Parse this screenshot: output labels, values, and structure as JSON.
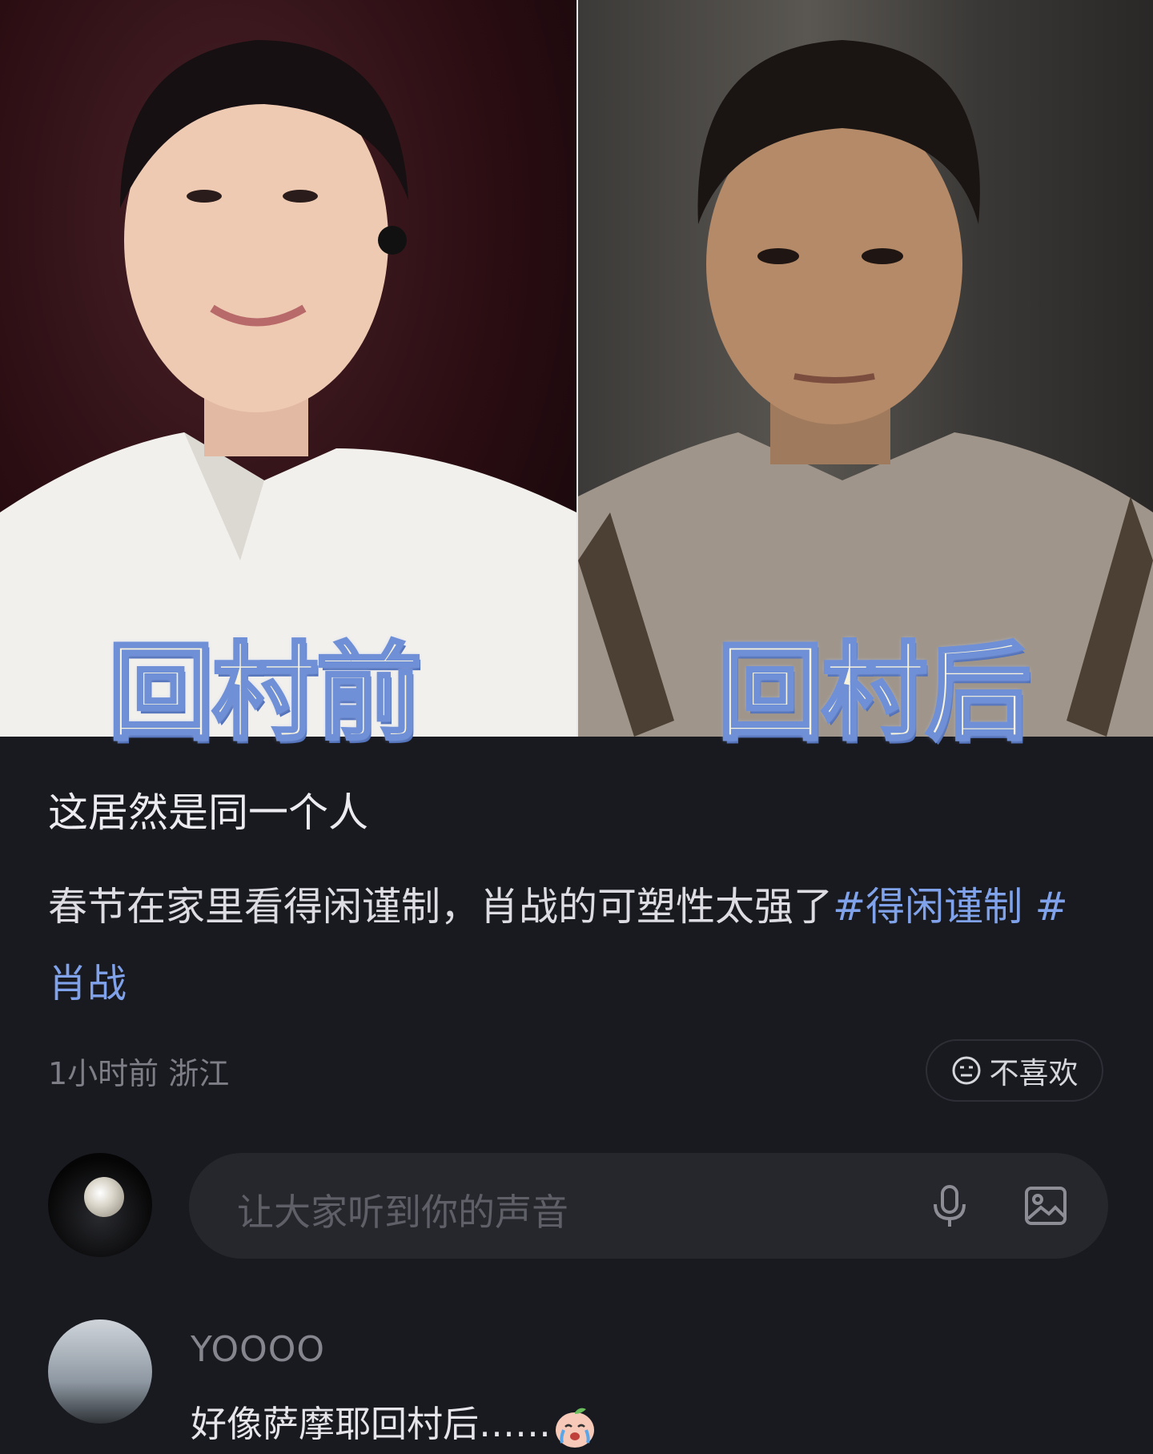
{
  "hero": {
    "left_caption": "回村前",
    "right_caption": "回村后"
  },
  "post": {
    "title": "这居然是同一个人",
    "body": "春节在家里看得闲谨制，肖战的可塑性太强了",
    "tags": [
      "#得闲谨制",
      "#肖战"
    ],
    "time": "1小时前",
    "location": "浙江",
    "dislike_label": "不喜欢"
  },
  "composer": {
    "placeholder": "让大家听到你的声音",
    "icons": [
      "microphone-icon",
      "image-icon"
    ]
  },
  "comments": [
    {
      "username": "YOOOO",
      "text": "好像萨摩耶回村后……",
      "emoji": "crying-peach-emoji"
    }
  ],
  "colors": {
    "background": "#191a20",
    "tag": "#7fa2ea",
    "caption_fill": "#f7f3dc",
    "caption_outline": "#6f8fd6"
  }
}
